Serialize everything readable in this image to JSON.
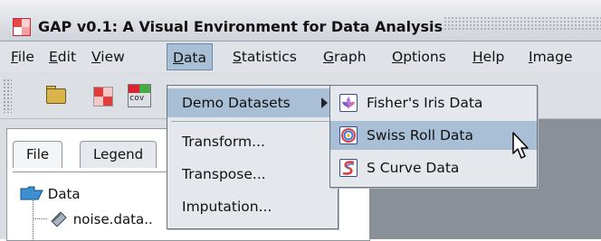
{
  "window": {
    "title": "GAP v0.1: A Visual Environment for Data Analysis"
  },
  "menubar": {
    "items": [
      {
        "label": "File"
      },
      {
        "label": "Edit"
      },
      {
        "label": "View"
      },
      {
        "label": "Data"
      },
      {
        "label": "Statistics"
      },
      {
        "label": "Graph"
      },
      {
        "label": "Options"
      },
      {
        "label": "Help"
      },
      {
        "label": "Image"
      }
    ],
    "active": "Data"
  },
  "toolbar": {
    "buttons": [
      {
        "icon": "open-folder-icon"
      },
      {
        "icon": "heatmap-icon"
      },
      {
        "icon": "cov-icon",
        "label": "cov"
      }
    ]
  },
  "left_panel": {
    "tabs": [
      {
        "label": "File"
      },
      {
        "label": "Legend"
      }
    ],
    "selected_tab": "File",
    "tree": {
      "root": "Data",
      "child": "noise.data.."
    }
  },
  "data_menu": {
    "items": [
      {
        "label": "Demo Datasets",
        "submenu": true
      },
      {
        "label": "Transform..."
      },
      {
        "label": "Transpose..."
      },
      {
        "label": "Imputation..."
      }
    ],
    "highlighted": "Demo Datasets"
  },
  "demo_submenu": {
    "items": [
      {
        "label": "Fisher's Iris Data",
        "icon": "iris-icon"
      },
      {
        "label": "Swiss Roll Data",
        "icon": "swiss-roll-icon"
      },
      {
        "label": "S Curve Data",
        "icon": "s-curve-icon"
      }
    ],
    "highlighted": "Swiss Roll Data"
  },
  "colors": {
    "highlight": "#a9bfd6",
    "menu_bg": "#e4e7eb",
    "desktop": "#8a9097"
  }
}
